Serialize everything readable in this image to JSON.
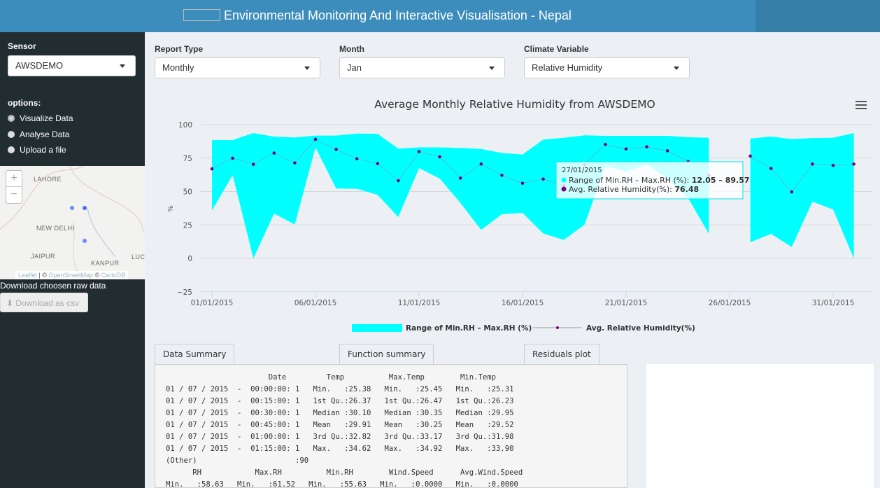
{
  "header": {
    "title": "Environmental Monitoring And Interactive Visualisation - Nepal",
    "menu_icon": "hamburger-icon"
  },
  "sidebar": {
    "sensor_label": "Sensor",
    "sensor_value": "AWSDEMO",
    "options_label": "options:",
    "options": [
      {
        "label": "Visualize Data",
        "selected": true
      },
      {
        "label": "Analyse Data",
        "selected": false
      },
      {
        "label": "Upload a file",
        "selected": false
      }
    ],
    "map": {
      "cities": [
        "LAHORE",
        "NEW DELHI",
        "JAIPUR",
        "KANPUR",
        "LUC"
      ],
      "zoom_in": "+",
      "zoom_out": "−",
      "attribution": {
        "leaflet": "Leaflet",
        "sep": " | © ",
        "osm": "OpenStreetMap",
        "sep2": " © ",
        "carto": "CartoDB"
      }
    },
    "download_label": "Download choosen raw data",
    "download_button": "Download as csv"
  },
  "filters": [
    {
      "label": "Report Type",
      "value": "Monthly"
    },
    {
      "label": "Month",
      "value": "Jan"
    },
    {
      "label": "Climate Variable",
      "value": "Relative Humidity"
    }
  ],
  "chart_data": {
    "type": "area",
    "title": "Average Monthly Relative Humidity from AWSDEMO",
    "ylabel": "%",
    "ylim": [
      -25,
      100
    ],
    "yticks": [
      -25,
      0,
      25,
      50,
      75,
      100
    ],
    "xticks": [
      "01/01/2015",
      "06/01/2015",
      "11/01/2015",
      "16/01/2015",
      "21/01/2015",
      "26/01/2015",
      "31/01/2015"
    ],
    "grid": true,
    "legend_position": "bottom",
    "x": [
      "01/01/2015",
      "02/01/2015",
      "03/01/2015",
      "04/01/2015",
      "05/01/2015",
      "06/01/2015",
      "07/01/2015",
      "08/01/2015",
      "09/01/2015",
      "10/01/2015",
      "11/01/2015",
      "12/01/2015",
      "13/01/2015",
      "14/01/2015",
      "15/01/2015",
      "16/01/2015",
      "17/01/2015",
      "18/01/2015",
      "19/01/2015",
      "20/01/2015",
      "21/01/2015",
      "22/01/2015",
      "23/01/2015",
      "24/01/2015",
      "25/01/2015",
      "26/01/2015",
      "27/01/2015",
      "28/01/2015",
      "29/01/2015",
      "30/01/2015",
      "31/01/2015",
      "01/02/2015"
    ],
    "series": [
      {
        "name": "Range of Min.RH – Max.RH (%)",
        "type": "arearange",
        "color": "#00ffff",
        "low": [
          35.8,
          62.3,
          0,
          33.5,
          25.3,
          82.9,
          52.2,
          52,
          47.5,
          30.9,
          67.5,
          59.7,
          41.4,
          21.3,
          33,
          34,
          18.6,
          13.8,
          25.3,
          69,
          65,
          70,
          60,
          45,
          18.3,
          null,
          12.05,
          18.3,
          8.5,
          42.4,
          36.5,
          0
        ],
        "high": [
          88.5,
          88.5,
          93.7,
          91,
          90.4,
          91.8,
          91.8,
          93.3,
          93.1,
          82,
          83,
          83,
          82.5,
          81.8,
          78.8,
          77.7,
          88.8,
          90.2,
          92,
          91.6,
          91.6,
          91.6,
          91.6,
          90.6,
          90.2,
          null,
          89.57,
          91.1,
          89.2,
          90,
          90.2,
          93.7
        ]
      },
      {
        "name": "Avg. Relative Humidity(%)",
        "type": "line",
        "color": "#800080",
        "values": [
          66.9,
          74.9,
          70.3,
          78.7,
          71.4,
          89,
          81.5,
          74.5,
          70.9,
          58.1,
          79.8,
          75.9,
          60,
          70.5,
          62.1,
          56.2,
          59.3,
          54.5,
          70,
          85.2,
          81.8,
          83.4,
          80.4,
          72.4,
          62,
          null,
          76.48,
          67.2,
          49.7,
          70.5,
          69.5,
          70.5
        ]
      }
    ],
    "tooltip": {
      "date": "27/01/2015",
      "range_label": "Range of Min.RH – Max.RH (%): ",
      "range_value": "12.05 – 89.57",
      "avg_label": "Avg. Relative Humidity(%): ",
      "avg_value": "76.48"
    }
  },
  "tabs": [
    {
      "label": "Data Summary",
      "active": true
    },
    {
      "label": "Function summary",
      "active": false
    },
    {
      "label": "Residuals plot",
      "active": false
    }
  ],
  "summary_lines": [
    "                       Date         Temp          Max.Temp        Min.Temp",
    "01 / 07 / 2015  -  00:00:00: 1   Min.   :25.38   Min.   :25.45   Min.   :25.31",
    "01 / 07 / 2015  -  00:15:00: 1   1st Qu.:26.37   1st Qu.:26.47   1st Qu.:26.23",
    "01 / 07 / 2015  -  00:30:00: 1   Median :30.10   Median :30.35   Median :29.95",
    "01 / 07 / 2015  -  00:45:00: 1   Mean   :29.91   Mean   :30.25   Mean   :29.52",
    "01 / 07 / 2015  -  01:00:00: 1   3rd Qu.:32.82   3rd Qu.:33.17   3rd Qu.:31.98",
    "01 / 07 / 2015  -  01:15:00: 1   Max.   :34.62   Max.   :34.92   Max.   :33.90",
    "(Other)                      :90",
    "      RH            Max.RH          Min.RH        Wind.Speed      Avg.Wind.Speed",
    "Min.   :58.63   Min.   :61.52   Min.   :55.63   Min.   :0.0000   Min.   :0.0000"
  ]
}
